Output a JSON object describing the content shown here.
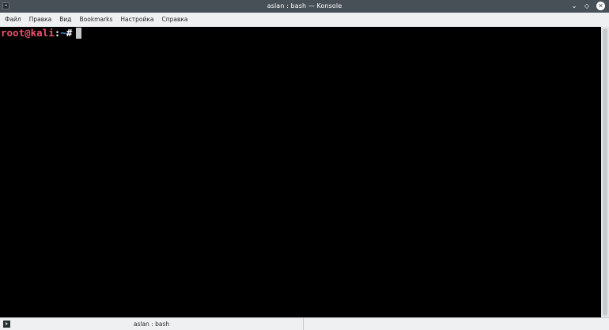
{
  "window": {
    "title": "aslan : bash — Konsole",
    "icon": "konsole-icon",
    "controls": {
      "minimize": "⌄",
      "maximize": "◇",
      "close": "✕"
    }
  },
  "menubar": {
    "items": [
      {
        "label": "Файл"
      },
      {
        "label": "Правка"
      },
      {
        "label": "Вид"
      },
      {
        "label": "Bookmarks"
      },
      {
        "label": "Настройка"
      },
      {
        "label": "Справка"
      }
    ]
  },
  "terminal": {
    "prompt_user": "root@kali",
    "prompt_sep": ":",
    "prompt_path": "~",
    "prompt_hash": "#",
    "colors": {
      "background": "#000000",
      "user": "#f0506e",
      "path": "#4d8fe8"
    }
  },
  "tabs": [
    {
      "label": "aslan : bash",
      "icon": "terminal-icon"
    }
  ]
}
